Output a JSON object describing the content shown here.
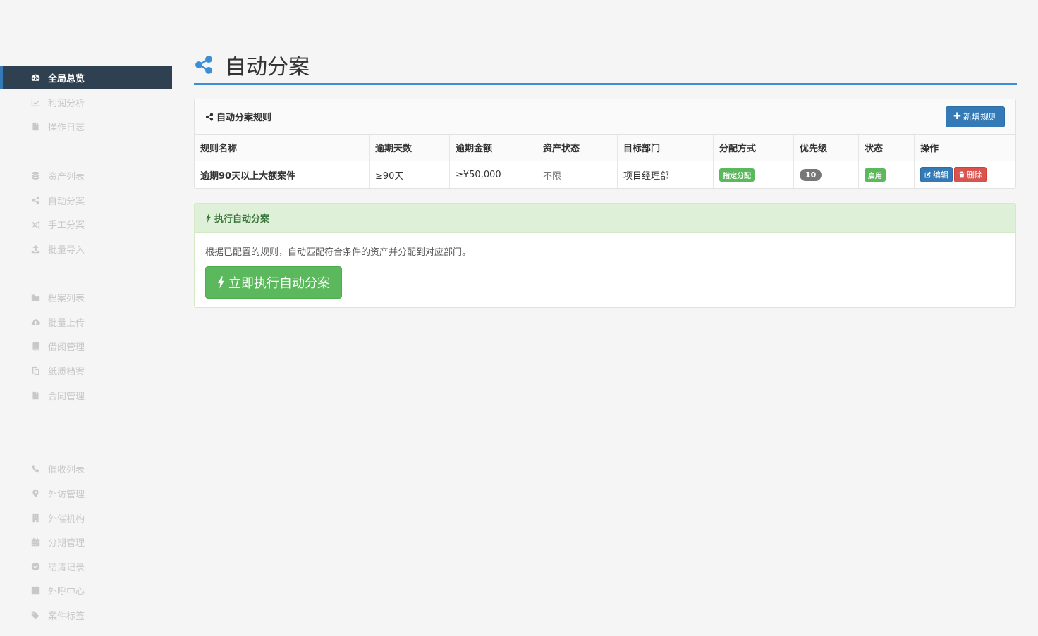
{
  "sidebar": {
    "items": [
      {
        "label": "全局总览",
        "icon": "dashboard-icon",
        "active": true
      },
      {
        "label": "利润分析",
        "icon": "line-chart-icon"
      },
      {
        "label": "操作日志",
        "icon": "file-icon"
      },
      {
        "label": "资产列表",
        "icon": "database-icon"
      },
      {
        "label": "自动分案",
        "icon": "share-icon"
      },
      {
        "label": "手工分案",
        "icon": "shuffle-icon"
      },
      {
        "label": "批量导入",
        "icon": "upload-icon"
      },
      {
        "label": "档案列表",
        "icon": "folder-icon"
      },
      {
        "label": "批量上传",
        "icon": "cloud-upload-icon"
      },
      {
        "label": "借阅管理",
        "icon": "book-icon"
      },
      {
        "label": "纸质档案",
        "icon": "copy-icon"
      },
      {
        "label": "合同管理",
        "icon": "file-icon"
      },
      {
        "label": "催收列表",
        "icon": "phone-icon"
      },
      {
        "label": "外访管理",
        "icon": "map-marker-icon"
      },
      {
        "label": "外催机构",
        "icon": "building-icon"
      },
      {
        "label": "分期管理",
        "icon": "calendar-icon"
      },
      {
        "label": "结清记录",
        "icon": "check-circle-icon"
      },
      {
        "label": "外呼中心",
        "icon": "phone-square-icon"
      },
      {
        "label": "案件标签",
        "icon": "tags-icon"
      }
    ]
  },
  "header": {
    "title": "自动分案",
    "icon": "share-icon"
  },
  "rules_panel": {
    "title": "自动分案规则",
    "add_button": "新增规则",
    "columns": [
      "规则名称",
      "逾期天数",
      "逾期金额",
      "资产状态",
      "目标部门",
      "分配方式",
      "优先级",
      "状态",
      "操作"
    ],
    "rows": [
      {
        "name": "逾期90天以上大额案件",
        "overdue_days": "≥90天",
        "overdue_amount": "≥¥50,000",
        "asset_status": "不限",
        "target_dept": "项目经理部",
        "assign_method": "指定分配",
        "priority": "10",
        "status": "启用",
        "edit_label": "编辑",
        "delete_label": "删除"
      }
    ]
  },
  "exec_panel": {
    "title": "执行自动分案",
    "description": "根据已配置的规则，自动匹配符合条件的资产并分配到对应部门。",
    "run_button": "立即执行自动分案"
  },
  "colors": {
    "primary": "#337ab7",
    "success": "#5cb85c",
    "danger": "#d9534f",
    "sidebar_active_bg": "#2f4050",
    "header_accent": "#3a8fd6"
  }
}
